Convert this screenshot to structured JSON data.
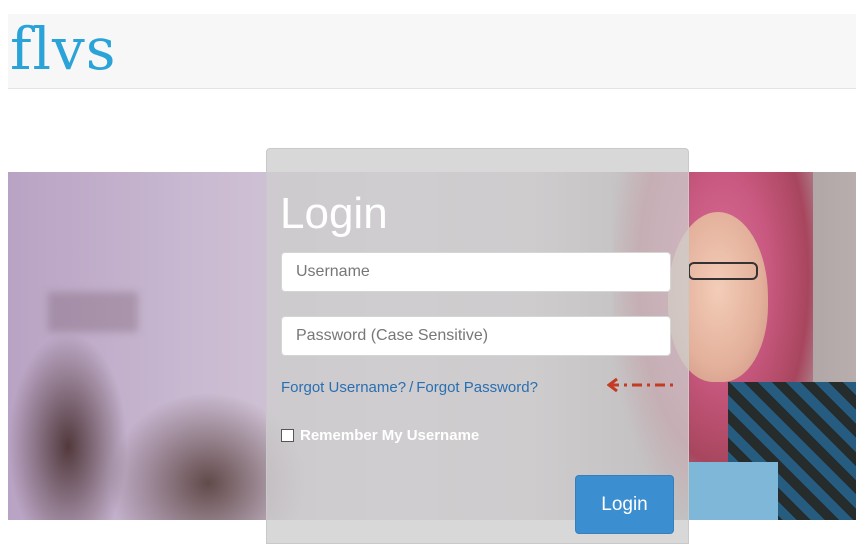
{
  "header": {
    "logo_text": "flvs"
  },
  "login": {
    "title": "Login",
    "username_placeholder": "Username",
    "password_placeholder": "Password (Case Sensitive)",
    "forgot_username": "Forgot Username?",
    "separator": "/",
    "forgot_password": "Forgot Password?",
    "remember_label": "Remember My Username",
    "remember_checked": false,
    "login_button": "Login"
  },
  "icons": {
    "annotation_arrow": "dashed-arrow-left-icon"
  },
  "colors": {
    "brand": "#2aa3d8",
    "link": "#2a6fb0",
    "button": "#3b8ed0",
    "annotation_arrow": "#c23b22"
  }
}
